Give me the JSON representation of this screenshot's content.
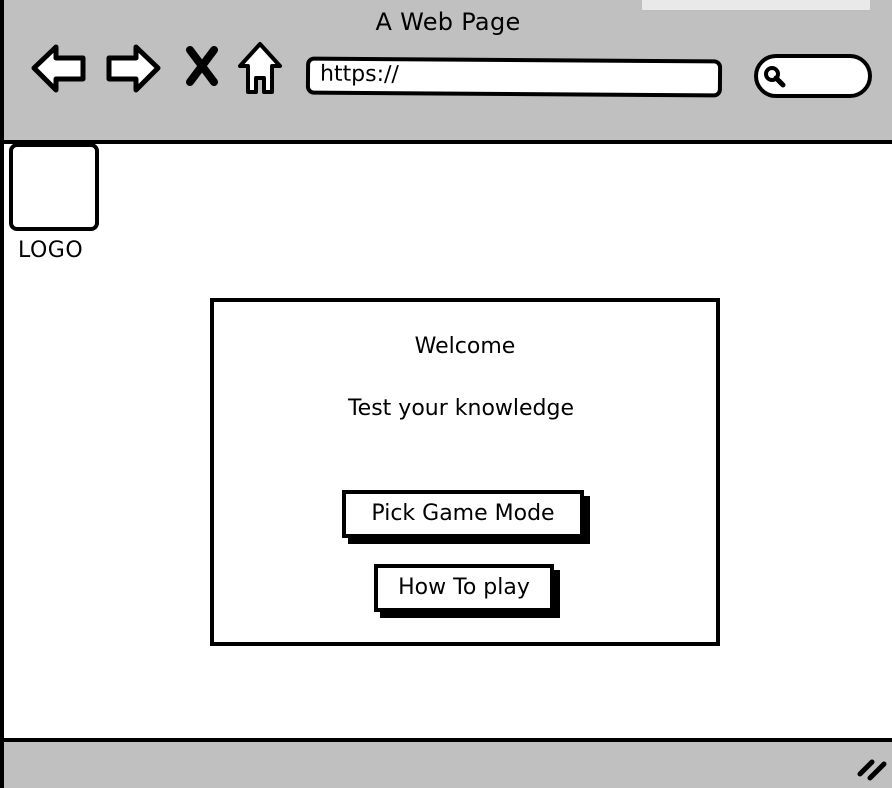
{
  "window": {
    "title": "A Web Page"
  },
  "toolbar": {
    "back_icon": "back-arrow-icon",
    "forward_icon": "forward-arrow-icon",
    "stop_icon": "close-x-icon",
    "home_icon": "home-icon",
    "search_icon": "magnifier-icon"
  },
  "address_bar": {
    "value": "https://"
  },
  "logo": {
    "label": "LOGO"
  },
  "main": {
    "welcome": "Welcome",
    "subtitle": "Test your knowledge",
    "buttons": {
      "game_mode": "Pick Game Mode",
      "how_to_play": "How To play"
    }
  },
  "colors": {
    "chrome": "#c0c0c0",
    "ink": "#000000",
    "background": "#ffffff"
  }
}
